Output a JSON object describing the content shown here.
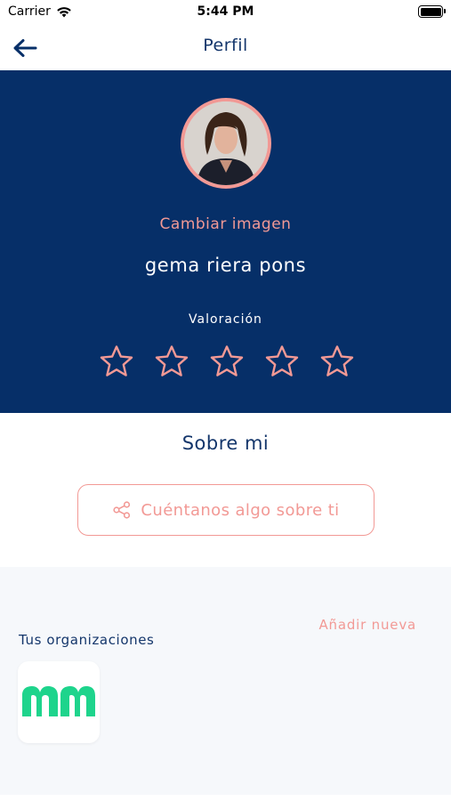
{
  "status_bar": {
    "carrier": "Carrier",
    "time": "5:44 PM"
  },
  "nav": {
    "title": "Perfil",
    "back_icon": "arrow-left-icon"
  },
  "profile": {
    "change_image_label": "Cambiar imagen",
    "name": "gema riera pons",
    "rating_label": "Valoración",
    "rating_value": 0,
    "rating_max": 5
  },
  "about": {
    "title": "Sobre mi",
    "button_label": "Cuéntanos algo sobre ti",
    "button_icon": "share-icon"
  },
  "organizations": {
    "title": "Tus organizaciones",
    "add_label": "Añadir nueva",
    "items": [
      {
        "logo": "nn-logo"
      }
    ]
  },
  "colors": {
    "navy": "#062f68",
    "title_blue": "#14366b",
    "accent_pink": "#f29995",
    "org_green": "#1ed48c"
  }
}
